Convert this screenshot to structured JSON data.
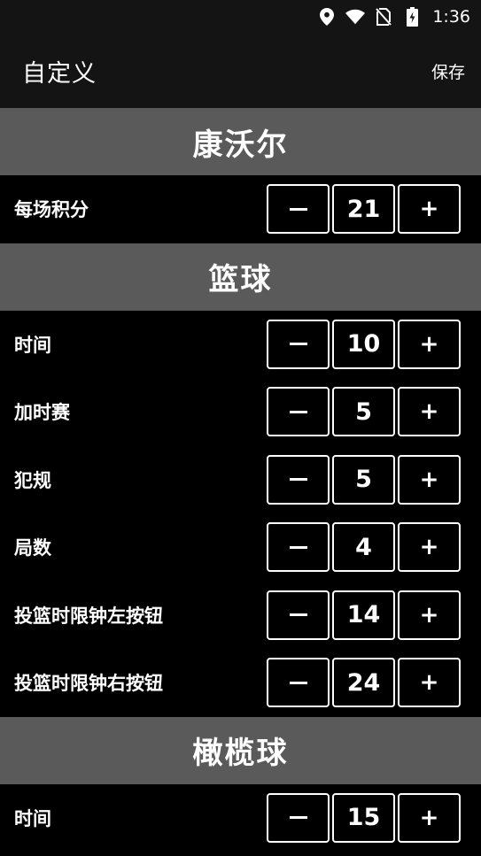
{
  "status_bar": {
    "time": "1:36",
    "icons": [
      "location-icon",
      "wifi-icon",
      "no-sim-icon",
      "battery-charging-icon"
    ]
  },
  "app_bar": {
    "title": "自定义",
    "save_label": "保存"
  },
  "sections": [
    {
      "title": "康沃尔",
      "rows": [
        {
          "label": "每场积分",
          "value": "21"
        }
      ]
    },
    {
      "title": "篮球",
      "rows": [
        {
          "label": "时间",
          "value": "10"
        },
        {
          "label": "加时赛",
          "value": "5"
        },
        {
          "label": "犯规",
          "value": "5"
        },
        {
          "label": "局数",
          "value": "4"
        },
        {
          "label": "投篮时限钟左按钮",
          "value": "14"
        },
        {
          "label": "投篮时限钟右按钮",
          "value": "24"
        }
      ]
    },
    {
      "title": "橄榄球",
      "rows": [
        {
          "label": "时间",
          "value": "15"
        }
      ]
    }
  ],
  "stepper": {
    "minus_symbol": "–",
    "plus_symbol": "+"
  },
  "colors": {
    "background": "#000000",
    "bar": "#141414",
    "section_header": "#5a5a5a",
    "text": "#ffffff"
  }
}
